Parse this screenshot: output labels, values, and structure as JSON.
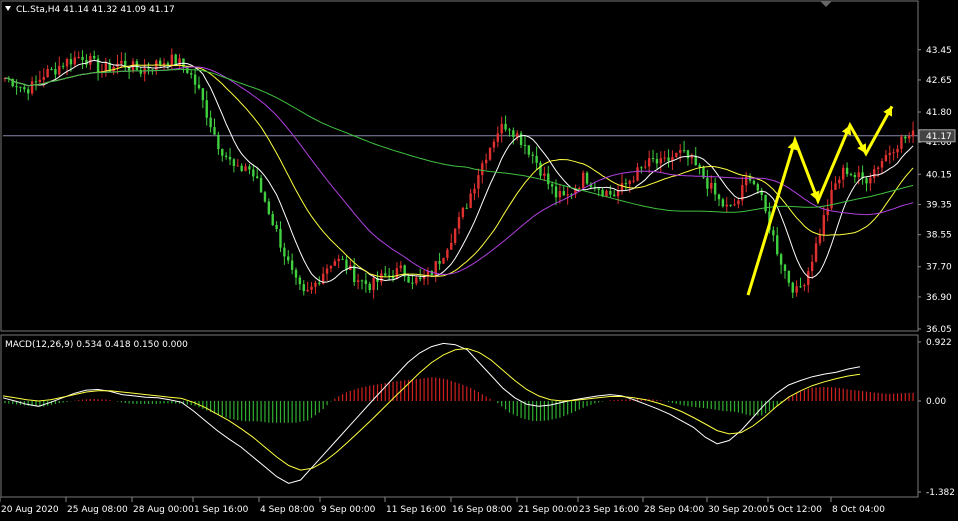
{
  "header": {
    "symbol_label": "CL.Sta,H4  41.14 41.32 41.09 41.17",
    "macd_label": "MACD(12,26,9) 0.534 0.418 0.150 0.000"
  },
  "colors": {
    "background": "#000000",
    "bull_candle": "#e03030",
    "bear_candle": "#40d040",
    "ma_fast": "#ffffff",
    "ma_mid": "#ffff40",
    "ma_slow": "#b040e0",
    "ma_long": "#40c040",
    "macd_pos": "#d02020",
    "macd_neg": "#30b030",
    "macd_line": "#ffffff",
    "signal_line": "#ffff40",
    "arrows": "#ffff00",
    "axis_text": "#ffffff",
    "price_line": "#8888aa"
  },
  "chart_data": [
    {
      "type": "candlestick",
      "title": "CL.Sta,H4",
      "ohlc_last": {
        "open": 41.14,
        "high": 41.32,
        "low": 41.09,
        "close": 41.17
      },
      "current_price_label": "41.17",
      "ylim": [
        36.05,
        44.0
      ],
      "yticks": [
        "43.45",
        "42.65",
        "41.80",
        "41.00",
        "40.15",
        "39.35",
        "38.55",
        "37.70",
        "36.90",
        "36.05"
      ],
      "x_categories": [
        "20 Aug 2020",
        "25 Aug 08:00",
        "28 Aug 00:00",
        "1 Sep 16:00",
        "4 Sep 08:00",
        "9 Sep 00:00",
        "11 Sep 16:00",
        "16 Sep 08:00",
        "21 Sep 00:00",
        "23 Sep 16:00",
        "28 Sep 04:00",
        "30 Sep 20:00",
        "5 Oct 12:00",
        "8 Oct 04:00"
      ],
      "close_path": [
        42.7,
        42.6,
        42.4,
        42.5,
        42.8,
        42.9,
        43.1,
        43.2,
        43.3,
        43.1,
        42.9,
        43.0,
        43.1,
        43.0,
        42.9,
        43.0,
        43.1,
        43.2,
        43.1,
        42.9,
        42.4,
        41.7,
        41.0,
        40.6,
        40.2,
        40.4,
        40.0,
        39.4,
        38.7,
        38.0,
        37.3,
        36.9,
        37.2,
        37.6,
        37.9,
        37.8,
        37.5,
        37.3,
        37.2,
        37.4,
        37.5,
        37.6,
        37.4,
        37.3,
        37.5,
        37.9,
        38.4,
        38.9,
        39.5,
        40.2,
        40.8,
        41.3,
        41.5,
        41.2,
        40.9,
        40.5,
        40.0,
        39.6,
        39.5,
        39.8,
        40.1,
        39.9,
        39.7,
        39.6,
        39.8,
        40.1,
        40.3,
        40.5,
        40.4,
        40.6,
        40.7,
        40.5,
        40.2,
        39.8,
        39.4,
        39.2,
        39.5,
        40.2,
        39.7,
        38.9,
        38.1,
        37.4,
        37.0,
        37.5,
        38.3,
        39.2,
        39.9,
        40.3,
        40.1,
        40.0,
        40.3,
        40.6,
        40.9,
        41.1,
        41.17
      ],
      "series": [
        {
          "name": "MA fast",
          "color": "#ffffff",
          "period": 3
        },
        {
          "name": "MA mid",
          "color": "#ffff40",
          "period": 8
        },
        {
          "name": "MA slow",
          "color": "#b040e0",
          "period": 14
        },
        {
          "name": "MA long",
          "color": "#40c040",
          "period": 40
        }
      ],
      "annotations": {
        "zigzag_prices": [
          36.95,
          41.05,
          39.45,
          41.45,
          40.7,
          41.95
        ]
      }
    },
    {
      "type": "macd",
      "title": "MACD(12,26,9)",
      "params": [
        12,
        26,
        9
      ],
      "values": {
        "macd": 0.534,
        "signal": 0.418,
        "hist": 0.15,
        "zero": 0.0
      },
      "ylim": [
        -1.382,
        0.922
      ],
      "yticks": [
        "0.922",
        "0.00",
        "-1.382"
      ],
      "macd_path": [
        0.05,
        0.0,
        -0.05,
        -0.08,
        -0.02,
        0.05,
        0.12,
        0.17,
        0.18,
        0.15,
        0.1,
        0.08,
        0.06,
        0.05,
        0.02,
        -0.02,
        -0.15,
        -0.3,
        -0.45,
        -0.58,
        -0.7,
        -0.85,
        -1.0,
        -1.15,
        -1.25,
        -1.2,
        -1.0,
        -0.8,
        -0.6,
        -0.4,
        -0.2,
        0.0,
        0.2,
        0.4,
        0.6,
        0.75,
        0.85,
        0.9,
        0.88,
        0.8,
        0.6,
        0.4,
        0.2,
        0.05,
        -0.05,
        -0.08,
        -0.06,
        -0.02,
        0.02,
        0.05,
        0.08,
        0.1,
        0.08,
        0.02,
        -0.05,
        -0.12,
        -0.2,
        -0.3,
        -0.4,
        -0.55,
        -0.65,
        -0.6,
        -0.45,
        -0.25,
        -0.05,
        0.12,
        0.25,
        0.32,
        0.38,
        0.42,
        0.45,
        0.5,
        0.534
      ],
      "signal_path": [
        0.08,
        0.05,
        0.02,
        0.0,
        0.02,
        0.06,
        0.1,
        0.14,
        0.16,
        0.16,
        0.14,
        0.12,
        0.1,
        0.08,
        0.06,
        0.04,
        -0.02,
        -0.1,
        -0.2,
        -0.3,
        -0.42,
        -0.55,
        -0.7,
        -0.85,
        -0.98,
        -1.05,
        -1.02,
        -0.92,
        -0.78,
        -0.62,
        -0.45,
        -0.28,
        -0.1,
        0.08,
        0.26,
        0.44,
        0.6,
        0.72,
        0.8,
        0.82,
        0.76,
        0.64,
        0.48,
        0.32,
        0.18,
        0.08,
        0.02,
        0.0,
        0.01,
        0.03,
        0.05,
        0.07,
        0.07,
        0.05,
        0.02,
        -0.03,
        -0.09,
        -0.16,
        -0.25,
        -0.35,
        -0.45,
        -0.5,
        -0.48,
        -0.38,
        -0.24,
        -0.08,
        0.06,
        0.16,
        0.24,
        0.3,
        0.35,
        0.39,
        0.418
      ]
    }
  ]
}
